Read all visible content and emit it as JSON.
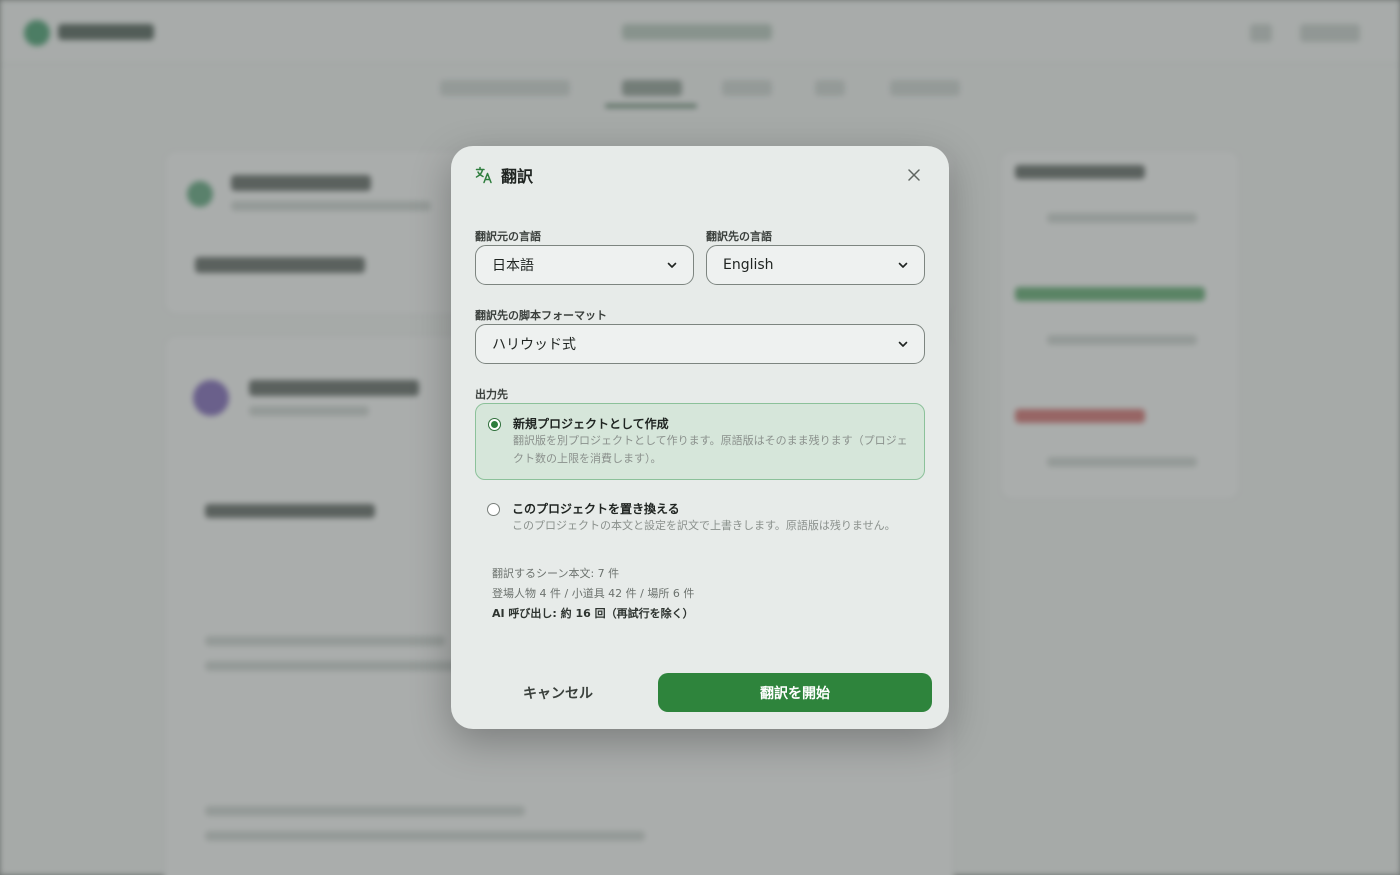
{
  "dialog": {
    "title": "翻訳",
    "source_language": {
      "label": "翻訳元の言語",
      "selected": "日本語"
    },
    "target_language": {
      "label": "翻訳先の言語",
      "selected": "English"
    },
    "script_format": {
      "label": "翻訳先の脚本フォーマット",
      "selected": "ハリウッド式"
    },
    "output": {
      "label": "出力先",
      "options": [
        {
          "title": "新規プロジェクトとして作成",
          "description": "翻訳版を別プロジェクトとして作ります。原語版はそのまま残ります（プロジェクト数の上限を消費します）。",
          "selected": true
        },
        {
          "title": "このプロジェクトを置き換える",
          "description": "このプロジェクトの本文と設定を訳文で上書きします。原語版は残りません。",
          "selected": false
        }
      ]
    },
    "summary": {
      "scenes": "翻訳するシーン本文: 7 件",
      "entities": "登場人物 4 件 / 小道具 42 件 / 場所 6 件",
      "ai_calls": "AI 呼び出し: 約 16 回（再試行を除く）"
    },
    "cancel_label": "キャンセル",
    "start_label": "翻訳を開始"
  },
  "colors": {
    "accent": "#2e843c",
    "selected_bg": "#d6e6da",
    "selected_border": "#8cc19a",
    "modal_bg": "#e7ebe9"
  },
  "icons": {
    "title_icon": "translate-icon",
    "close_icon": "close-icon",
    "select_chevron": "chevron-down-icon"
  }
}
